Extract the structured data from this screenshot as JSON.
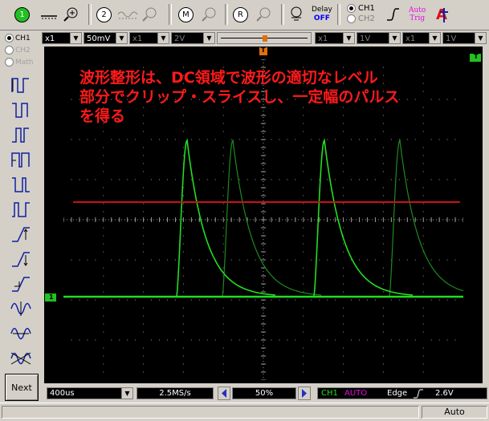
{
  "toolbar": {
    "btn1": "1",
    "btn2": "2",
    "btnM": "M",
    "btnR": "R",
    "delay_label": "Delay",
    "delay_state": "OFF",
    "ch1": "CH1",
    "ch2": "CH2",
    "auto_trig_1": "Auto",
    "auto_trig_2": "Trig",
    "trig_marker": "A"
  },
  "controls": {
    "ch1_probe": "x1",
    "ch1_vdiv": "50mV",
    "ch2_probe": "x1",
    "ch2_vdiv": "2V",
    "r1_probe": "x1",
    "r1_vdiv": "1V",
    "r2_probe": "x1",
    "r2_vdiv": "1V"
  },
  "channels": {
    "ch1": "CH1",
    "ch2": "CH2",
    "math": "Math"
  },
  "markers": {
    "trigger_pos": "T",
    "trigger_level": "T",
    "ch1_ground": "1"
  },
  "annotation": {
    "line1": "波形整形は、DC領域で波形の適切なレベル",
    "line2": "部分でクリップ・スライスし、一定幅のパルス",
    "line3": "を得る"
  },
  "bottom": {
    "timebase": "400us",
    "sample_rate": "2.5MS/s",
    "position": "50%",
    "trig_channel": "CH1",
    "trig_mode": "AUTO",
    "trig_type": "Edge",
    "trig_level": "2.6V"
  },
  "status": {
    "mode": "Auto"
  },
  "next_button": "Next",
  "colors": {
    "trace": "#22dd22",
    "slice_level": "#cc1111",
    "annotation": "#ff1a1a",
    "grid": "#9a9a9a"
  }
}
